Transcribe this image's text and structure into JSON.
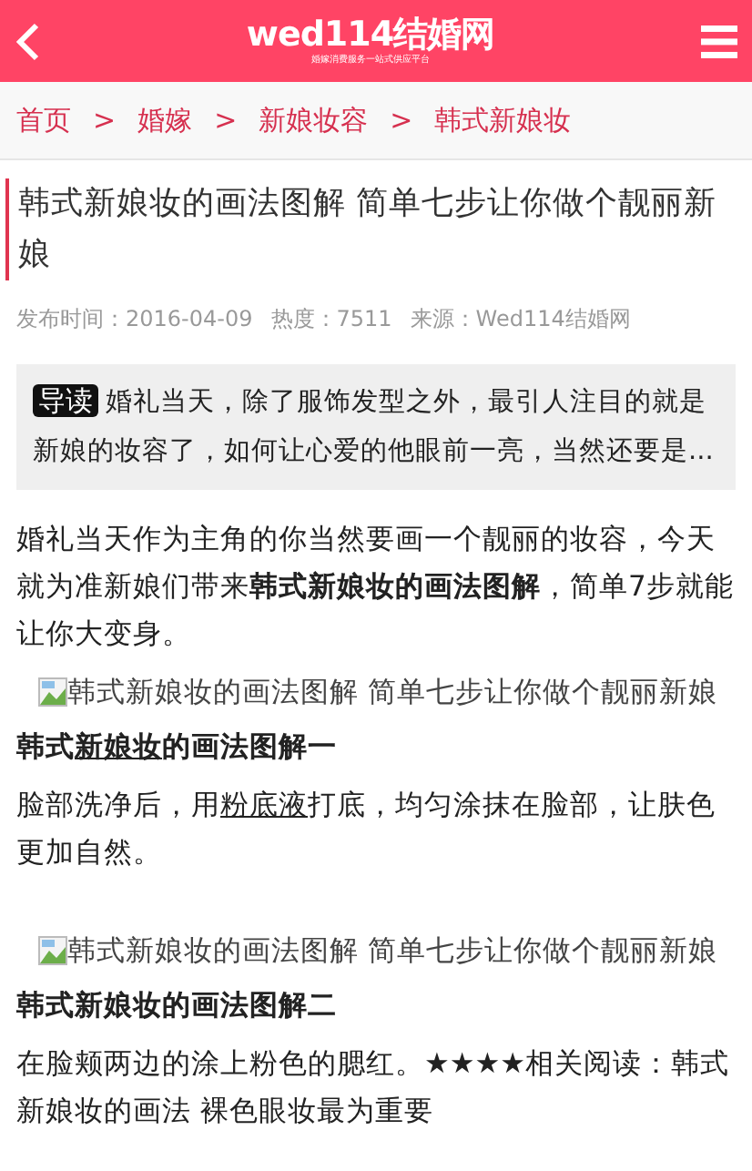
{
  "header": {
    "logo": "wed114结婚网",
    "tagline": "婚嫁消费服务一站式供应平台"
  },
  "breadcrumb": [
    "首页",
    "婚嫁",
    "新娘妆容",
    "韩式新娘妆"
  ],
  "breadcrumb_separator": ">",
  "article": {
    "title": "韩式新娘妆的画法图解 简单七步让你做个靓丽新娘",
    "meta": [
      "发布时间：2016-04-09",
      "热度：7511",
      "来源：Wed114结婚网"
    ],
    "summary": {
      "badge": "导读",
      "text": "婚礼当天，除了服饰发型之外，最引人注目的就是新娘的妆容了，如何让心爱的他眼前一亮，当然还要是..."
    },
    "content": [
      {
        "kind": "paragraph",
        "parts": [
          {
            "text": "婚礼当天作为主角的你当然要画一个靓丽的妆容，今天就为准新娘们带来**韩式新娘妆的画法图解**，简单7步就能让你大变身。",
            "link": false
          }
        ]
      },
      {
        "kind": "image",
        "alt": "韩式新娘妆的画法图解 简单七步让你做个靓丽新娘"
      },
      {
        "kind": "heading",
        "parts": [
          {
            "text": "韩式",
            "link": false
          },
          {
            "text": "新娘妆",
            "link": true
          },
          {
            "text": "的画法图解一",
            "link": false
          }
        ]
      },
      {
        "kind": "paragraph",
        "parts": [
          {
            "text": "脸部洗净后，用",
            "link": false
          },
          {
            "text": "粉底液",
            "link": true
          },
          {
            "text": "打底，均匀涂抹在脸部，让肤色更加自然。",
            "link": false
          }
        ]
      },
      {
        "kind": "spacer"
      },
      {
        "kind": "image",
        "alt": "韩式新娘妆的画法图解 简单七步让你做个靓丽新娘"
      },
      {
        "kind": "heading",
        "parts": [
          {
            "text": "韩式新娘妆的画法图解二",
            "link": false
          }
        ]
      },
      {
        "kind": "paragraph",
        "parts": [
          {
            "text": "在脸颊两边的涂上粉色的腮红。★★★★相关阅读：韩式新娘妆的画法 裸色眼妆最为重要",
            "link": false
          }
        ]
      }
    ]
  }
}
